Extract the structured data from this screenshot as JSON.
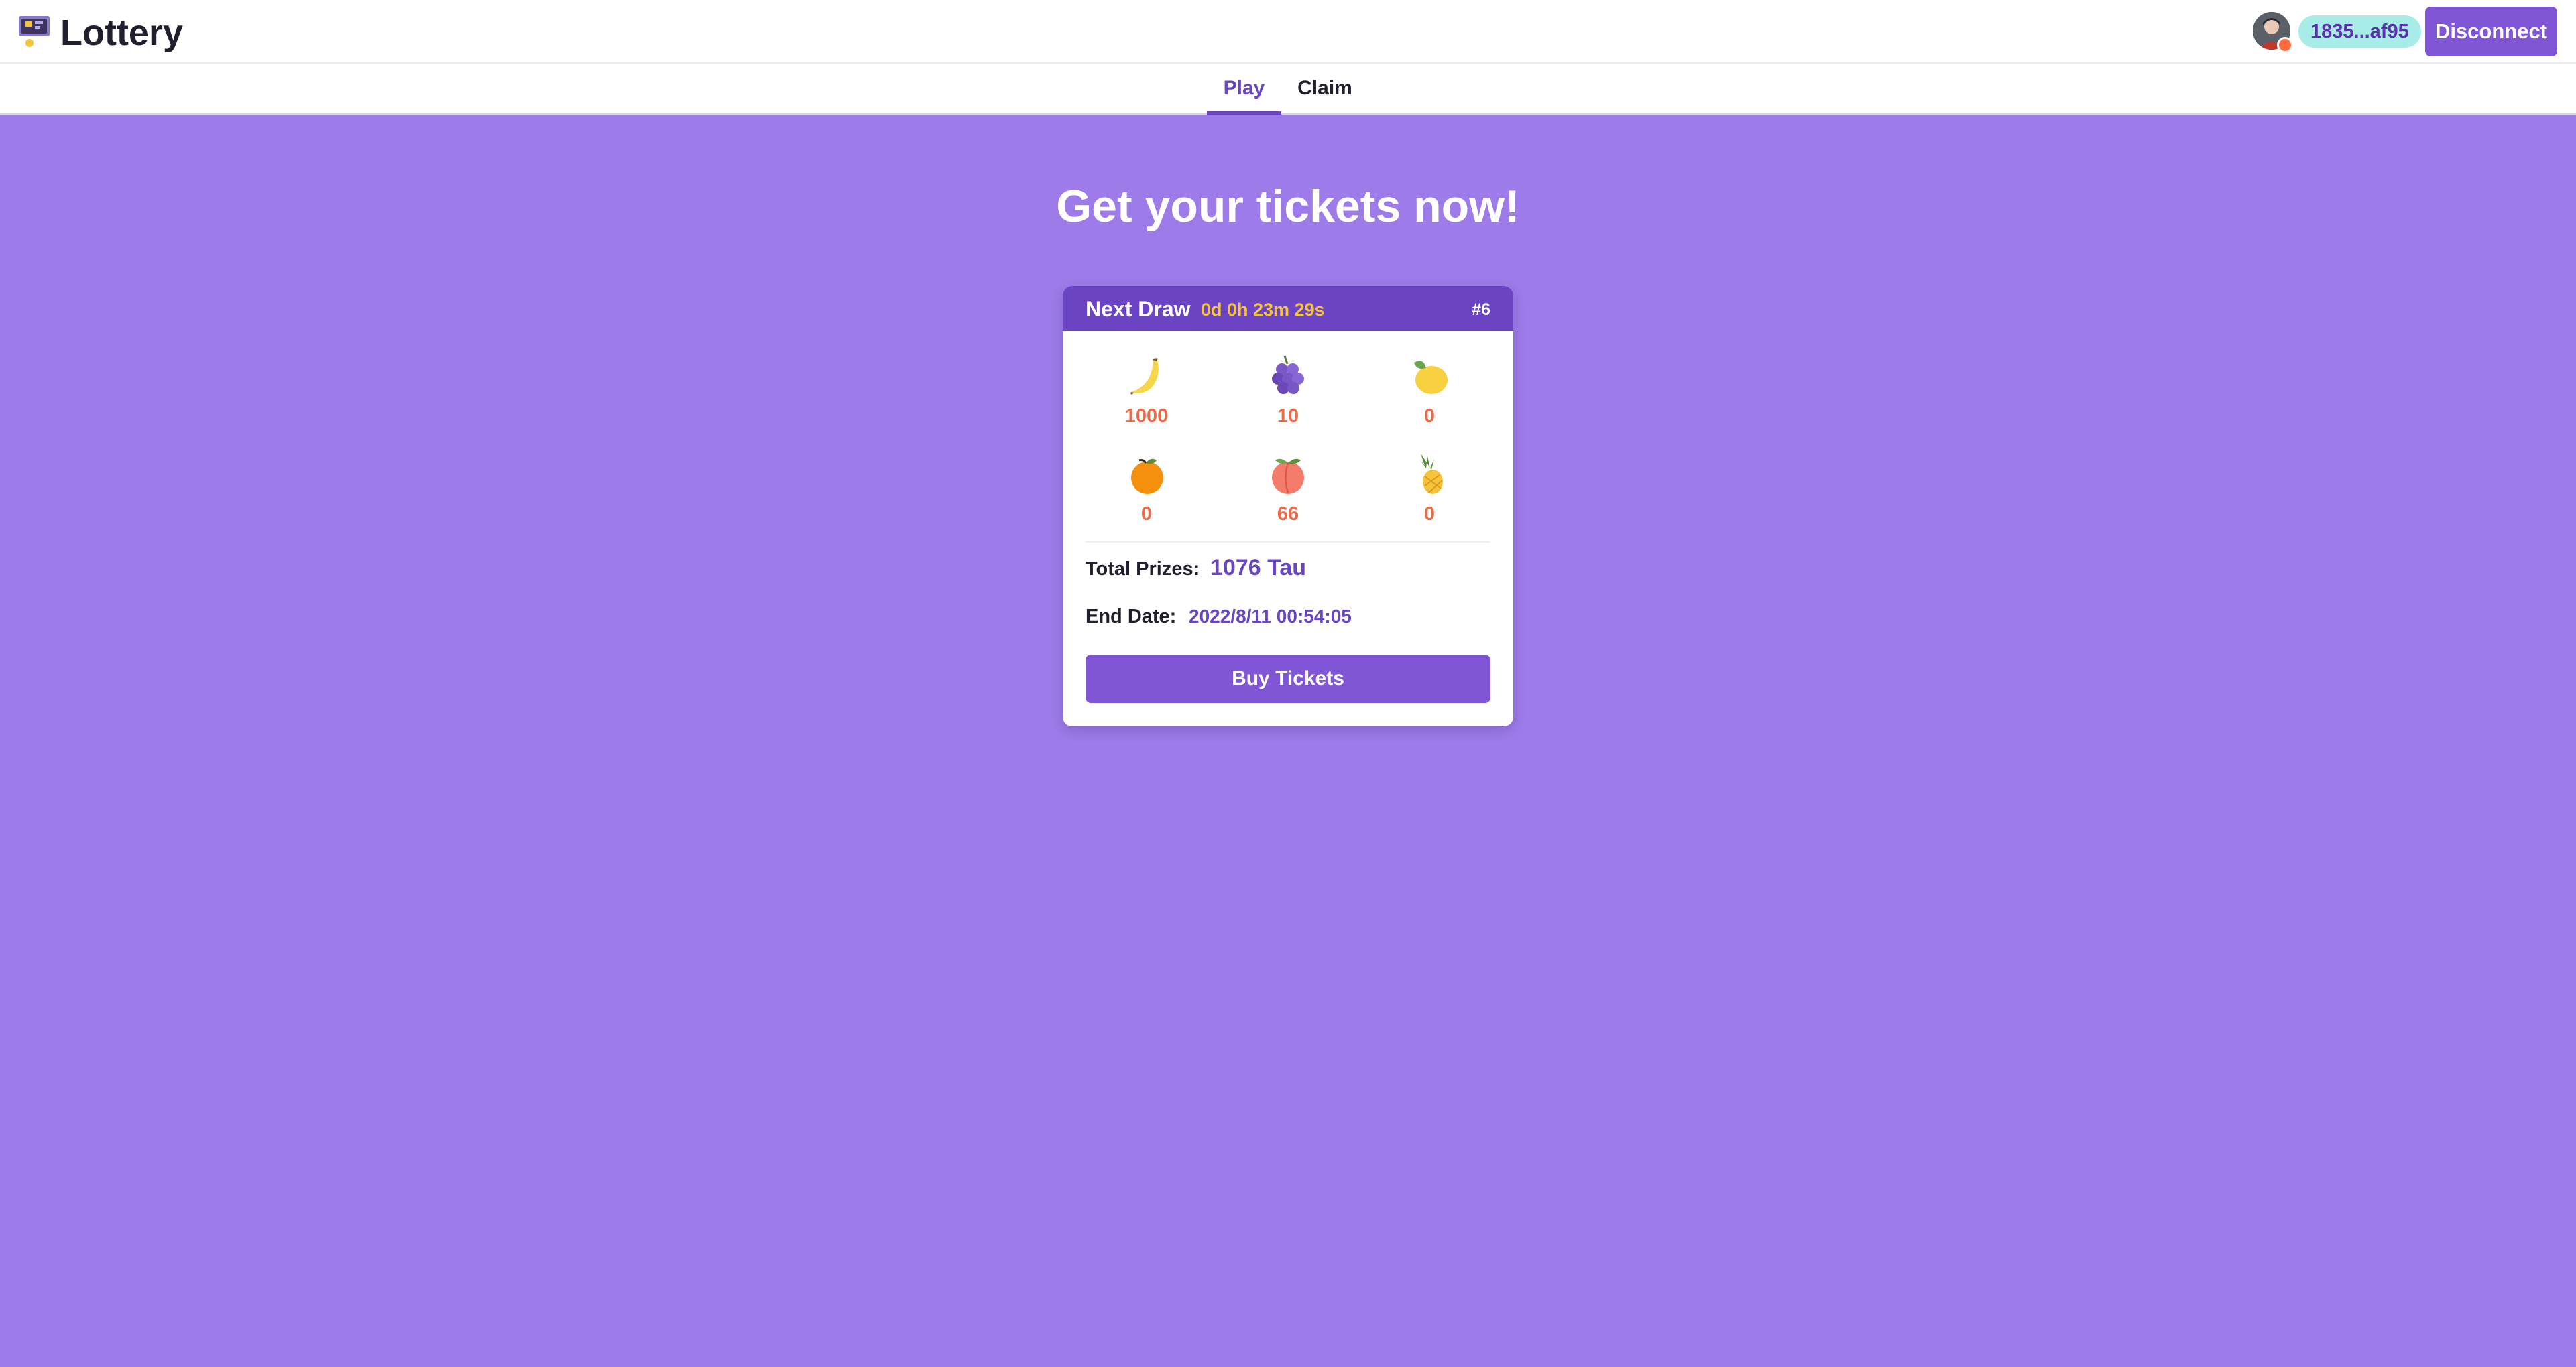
{
  "app": {
    "title": "Lottery",
    "logo_icon": "lottery-ticket-icon"
  },
  "wallet": {
    "avatar_icon": "user-avatar-icon",
    "status_color": "#ff6a3a",
    "address": "1835...af95",
    "disconnect_label": "Disconnect"
  },
  "nav": {
    "tabs": [
      {
        "label": "Play",
        "active": true
      },
      {
        "label": "Claim",
        "active": false
      }
    ]
  },
  "main": {
    "headline": "Get your tickets now!"
  },
  "draw_card": {
    "title": "Next Draw",
    "countdown": "0d 0h 23m 29s",
    "round": "#6",
    "fruits": [
      {
        "icon": "banana-icon",
        "count": "1000"
      },
      {
        "icon": "grapes-icon",
        "count": "10"
      },
      {
        "icon": "lemon-icon",
        "count": "0"
      },
      {
        "icon": "orange-icon",
        "count": "0"
      },
      {
        "icon": "peach-icon",
        "count": "66"
      },
      {
        "icon": "pineapple-icon",
        "count": "0"
      }
    ],
    "total_prizes_label": "Total Prizes:",
    "total_prizes_value": "1076 Tau",
    "end_date_label": "End Date:",
    "end_date_value": "2022/8/11 00:54:05",
    "buy_label": "Buy Tickets"
  },
  "colors": {
    "accent": "#8056d6",
    "header_purple": "#6b44c4",
    "background": "#9d7ce9",
    "timer": "#f6c33c",
    "count": "#ec6a45",
    "address_pill": "#a7ece6"
  }
}
